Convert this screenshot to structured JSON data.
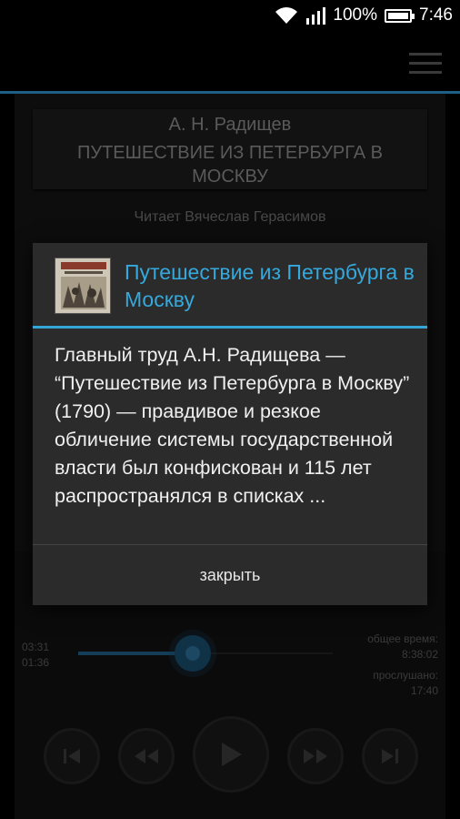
{
  "status": {
    "battery": "100%",
    "time": "7:46"
  },
  "book": {
    "author": "А. Н. Радищев",
    "title": "ПУТЕШЕСТВИЕ ИЗ ПЕТЕРБУРГА В МОСКВУ",
    "reader": "Читает Вячеслав Герасимов"
  },
  "player": {
    "elapsed": "03:31",
    "remaining": "01:36",
    "total_label": "общее время:",
    "total_value": "8:38:02",
    "listened_label": "прослушано:",
    "listened_value": "17:40",
    "progress": 0.45
  },
  "dialog": {
    "title": "Путешествие из Петербурга в Москву",
    "body": "Главный труд А.Н. Радищева — “Путешествие из Петербурга в Москву” (1790) — правдивое и резкое обличение системы государственной власти был конфискован и 115 лет распространялся в списках ...",
    "close_label": "закрыть"
  },
  "colors": {
    "accent": "#33a5d6",
    "dim_accent": "#1f5f86"
  }
}
